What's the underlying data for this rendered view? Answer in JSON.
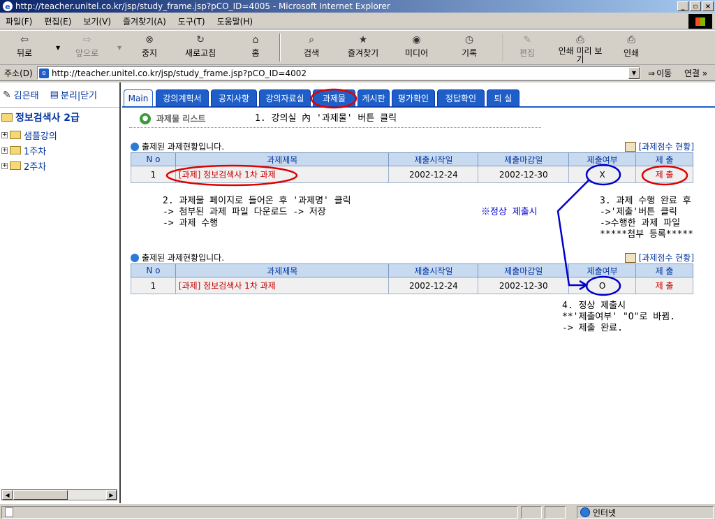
{
  "window": {
    "title": "http://teacher.unitel.co.kr/jsp/study_frame.jsp?pCO_ID=4005 - Microsoft Internet Explorer",
    "controls": [
      "_",
      "▫",
      "×"
    ]
  },
  "menu": [
    "파일(F)",
    "편집(E)",
    "보기(V)",
    "즐겨찾기(A)",
    "도구(T)",
    "도움말(H)"
  ],
  "toolbar": {
    "back": "뒤로",
    "forward": "앞으로",
    "stop": "중지",
    "refresh": "새로고침",
    "home": "홈",
    "search": "검색",
    "favorites": "즐겨찾기",
    "media": "미디어",
    "history": "기록",
    "edit": "편집",
    "print_preview": "인쇄 미리 보기",
    "print": "인쇄"
  },
  "address": {
    "label": "주소(D)",
    "url": "http://teacher.unitel.co.kr/jsp/study_frame.jsp?pCO_ID=4002",
    "go": "이동",
    "links": "연결 »"
  },
  "left": {
    "user": "김은태",
    "detach_label": "분리|닫기",
    "root": "정보검색사  2급",
    "nodes": [
      "샘플강의",
      "1주차",
      "2주차"
    ]
  },
  "tabs": [
    "Main",
    "강의계획서",
    "공지사항",
    "강의자료실",
    "과제물",
    "게시판",
    "평가확인",
    "정답확인",
    "퇴 실"
  ],
  "page": {
    "section_title": "과제물 리스트",
    "step1": "1. 강의실 內 '과제물' 버튼 클릭",
    "step2": "2. 과제물 페이지로 들어온 후 '과제명' 클릭\n-> 첨부된 과제 파일 다운로드 -> 저장\n-> 과제 수행",
    "normal_note": "※정상 제출시",
    "step3": "3. 과제 수행 완료 후\n->'제출'버튼 클릭\n->수행한 과제 파일\n*****첨부 등록*****",
    "step4": "4. 정상 제출시\n**'제출여부' \"O\"로 바뀜.\n-> 제출 완료."
  },
  "table1": {
    "heading": "출제된 과제현황입니다.",
    "score_link": "[과제점수 현황]",
    "headers": [
      "N o",
      "과제제목",
      "제출시작일",
      "제출마감일",
      "제출여부",
      "제 출"
    ],
    "row": [
      "1",
      "[과제] 정보검색사 1차 과제",
      "2002-12-24",
      "2002-12-30",
      "X",
      "제 출"
    ]
  },
  "table2": {
    "heading": "출제된 과제현황입니다.",
    "score_link": "[과제점수 현황]",
    "headers": [
      "N o",
      "과제제목",
      "제출시작일",
      "제출마감일",
      "제출여부",
      "제 출"
    ],
    "row": [
      "1",
      "[과제] 정보검색사 1차 과제",
      "2002-12-24",
      "2002-12-30",
      "O",
      "제 출"
    ]
  },
  "status": {
    "zone": "인터넷"
  },
  "colors": {
    "annotation_red": "#e00000",
    "annotation_blue": "#0000cc",
    "tab_blue": "#1e5ec8"
  }
}
